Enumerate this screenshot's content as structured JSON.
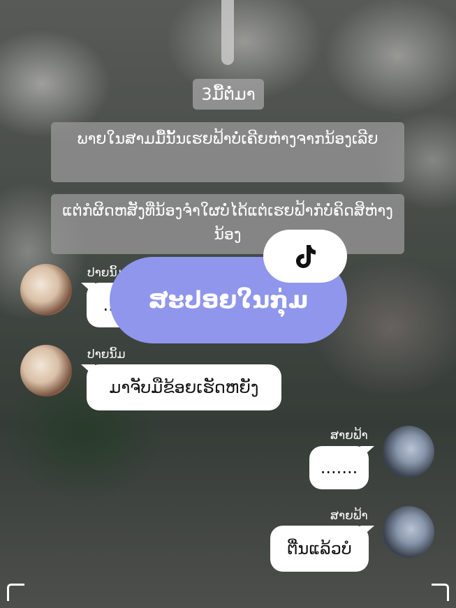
{
  "header": {
    "day_label": "3ມື້ຕໍ່ມາ"
  },
  "narration": [
    {
      "text": "ພາຍໃນສາມມື້ນັ້ນເຮຍຟ້າບໍ່ເຄີຍຫ່າງຈາກນ້ອງເລີຍ"
    },
    {
      "text": "ແຕ່ກໍຜິດຫສັງທີ່ນ້ອງຈຳໃຜບໍ່ໄດ້ແຕ່ເຮຍຟ້າກໍບໍ່ຄິດສິຫ່າງນ້ອງ"
    }
  ],
  "messages": [
    {
      "sender": "ປາຍນິ້ມ",
      "text": "...",
      "side": "left"
    },
    {
      "sender": "ປາຍນິ້ມ",
      "text": "ມາຈັບມືຂ້ອຍເຮັດຫຍັງ",
      "side": "left"
    },
    {
      "sender": "ສາຍຟ້າ",
      "text": ".......",
      "side": "right"
    },
    {
      "sender": "ສາຍຟ້າ",
      "text": "ຕື່ນແລ້ວບໍ",
      "side": "right"
    }
  ],
  "promo": {
    "label": "ສະປອຍໃນກຸ່ມ",
    "logo_icon": "tiktok-icon"
  },
  "colors": {
    "promo_bg": "#8f96ec",
    "bubble_bg": "#ffffff"
  }
}
